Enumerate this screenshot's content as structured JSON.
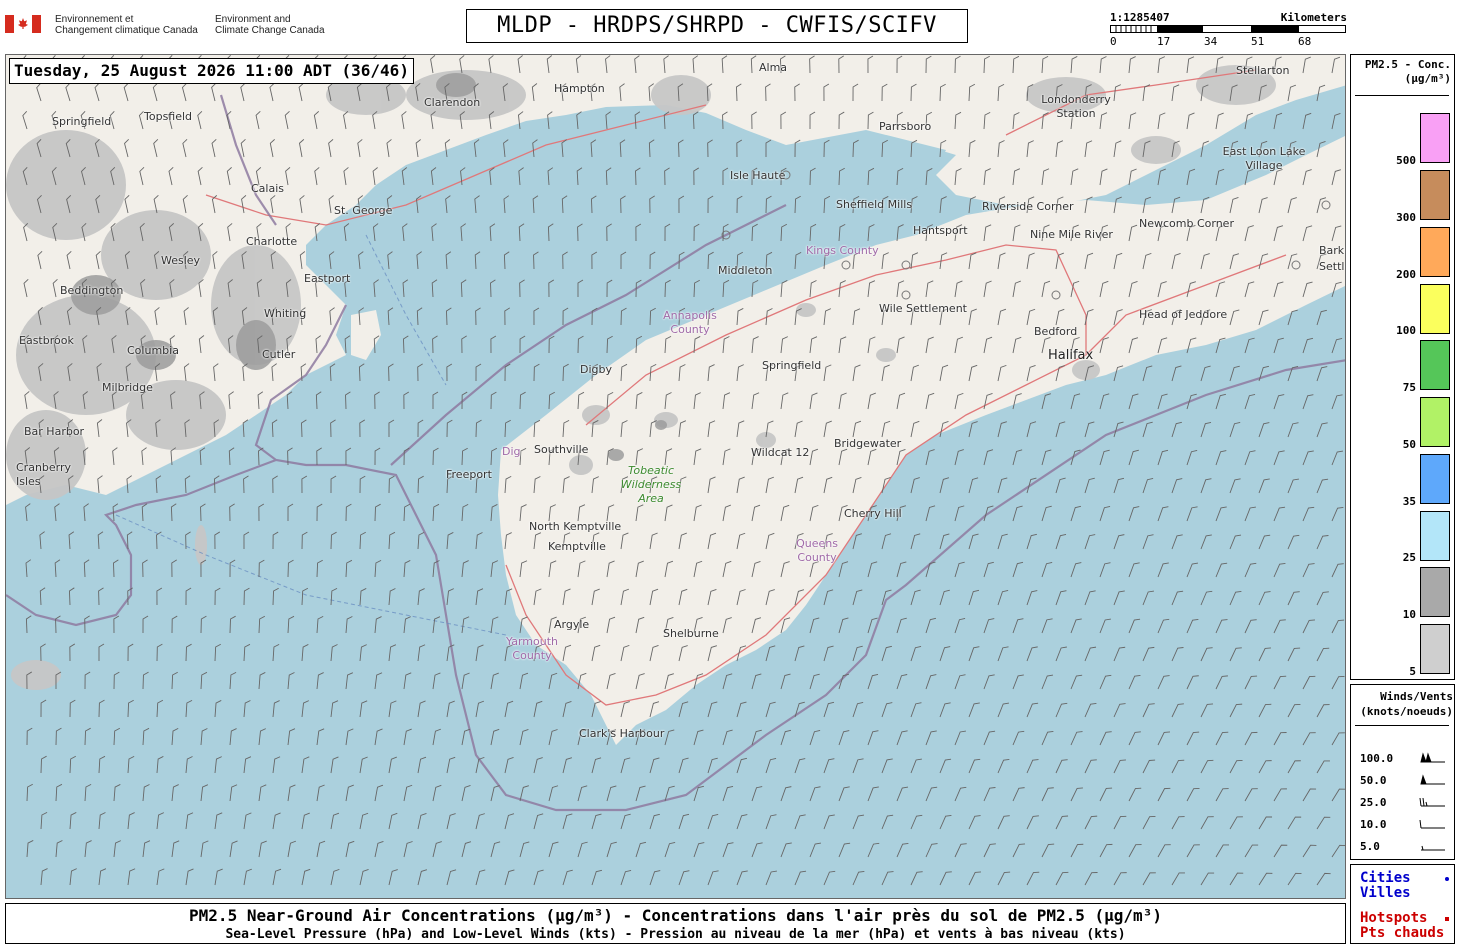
{
  "header": {
    "department_fr": "Environnement et\nChangement climatique Canada",
    "department_en": "Environment and\nClimate Change Canada",
    "title": "MLDP - HRDPS/SHRPD - CWFIS/SCIFV"
  },
  "scale": {
    "ratio": "1:1285407",
    "unit": "Kilometers",
    "ticks": [
      "0",
      "17",
      "34",
      "51",
      "68"
    ]
  },
  "map": {
    "timestamp": "Tuesday, 25 August 2026 11:00 ADT (36/46)",
    "colors": {
      "water": "#abd0dd",
      "land": "#f2efe9",
      "smoke_light": "#c6c6c6",
      "smoke_dark": "#9c9c9c",
      "roads": "#e0787a",
      "boundary": "#8e7aa0"
    },
    "places": [
      {
        "name": "Alma"
      },
      {
        "name": "Hampton"
      },
      {
        "name": "Clarendon"
      },
      {
        "name": "Springfield"
      },
      {
        "name": "Topsfield"
      },
      {
        "name": "Calais"
      },
      {
        "name": "St. George"
      },
      {
        "name": "Charlotte"
      },
      {
        "name": "Wesley"
      },
      {
        "name": "Eastport"
      },
      {
        "name": "Beddington"
      },
      {
        "name": "Whiting"
      },
      {
        "name": "Eastbrook"
      },
      {
        "name": "Columbia"
      },
      {
        "name": "Cutler"
      },
      {
        "name": "Milbridge"
      },
      {
        "name": "Bar Harbor"
      },
      {
        "name": "Cranberry Isles"
      },
      {
        "name": "Isle Haute"
      },
      {
        "name": "Parrsboro"
      },
      {
        "name": "Londonderry Station"
      },
      {
        "name": "Stellarton"
      },
      {
        "name": "East Loon Lake Village"
      },
      {
        "name": "Sheffield Mills"
      },
      {
        "name": "Riverside Corner"
      },
      {
        "name": "Newcomb Corner"
      },
      {
        "name": "Hantsport"
      },
      {
        "name": "Nine Mile River"
      },
      {
        "name": "Barkhouse Settlement"
      },
      {
        "name": "Kings County"
      },
      {
        "name": "Middleton"
      },
      {
        "name": "Wile Settlement"
      },
      {
        "name": "Annapolis County"
      },
      {
        "name": "Bedford"
      },
      {
        "name": "Head of Jeddore"
      },
      {
        "name": "Halifax"
      },
      {
        "name": "Digby"
      },
      {
        "name": "Springfield"
      },
      {
        "name": "Southville"
      },
      {
        "name": "Wildcat 12"
      },
      {
        "name": "Bridgewater"
      },
      {
        "name": "Freeport"
      },
      {
        "name": "Tobeatic Wilderness Area"
      },
      {
        "name": "Cherry Hill"
      },
      {
        "name": "North Kemptville"
      },
      {
        "name": "Kemptville"
      },
      {
        "name": "Queens County"
      },
      {
        "name": "Argyle"
      },
      {
        "name": "Yarmouth County"
      },
      {
        "name": "Shelburne"
      },
      {
        "name": "Clark's Harbour"
      },
      {
        "name": "Dig"
      }
    ]
  },
  "legend_pm25": {
    "title": "PM2.5 - Conc.\n(µg/m³)",
    "bins": [
      {
        "label": "500",
        "color": "#f9a0f5"
      },
      {
        "label": "300",
        "color": "#c68c5c"
      },
      {
        "label": "200",
        "color": "#ffa95a"
      },
      {
        "label": "100",
        "color": "#fbff5d"
      },
      {
        "label": "75",
        "color": "#55c659"
      },
      {
        "label": "50",
        "color": "#b1f266"
      },
      {
        "label": "35",
        "color": "#5ea8fb"
      },
      {
        "label": "25",
        "color": "#b3e6f9"
      },
      {
        "label": "10",
        "color": "#a9a9a9"
      },
      {
        "label": "5",
        "color": "#cfcfcf"
      }
    ]
  },
  "legend_winds": {
    "title": "Winds/Vents\n(knots/noeuds)",
    "rows": [
      "100.0",
      "50.0",
      "25.0",
      "10.0",
      "5.0"
    ]
  },
  "legend_places": {
    "cities_en": "Cities",
    "cities_fr": "Villes",
    "hotspots_en": "Hotspots",
    "hotspots_fr": "Pts chauds",
    "city_marker_color": "#0000cc",
    "hotspot_marker_color": "#cc0000"
  },
  "footer": {
    "line1": "PM2.5 Near-Ground Air Concentrations (µg/m³) - Concentrations dans l'air près du sol de PM2.5 (µg/m³)",
    "line2": "Sea-Level Pressure (hPa) and Low-Level Winds (kts) - Pression au niveau de la mer (hPa) et vents à bas niveau (kts)"
  }
}
